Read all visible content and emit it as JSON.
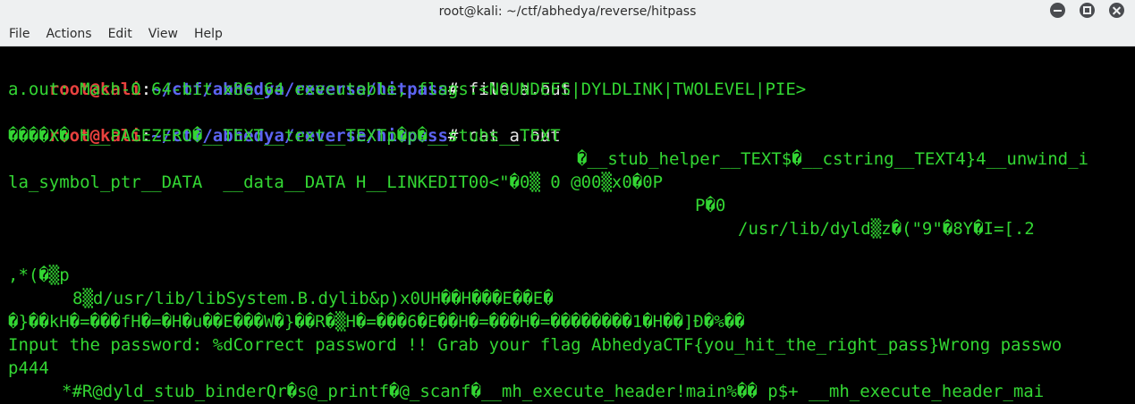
{
  "window": {
    "title": "root@kali: ~/ctf/abhedya/reverse/hitpass",
    "buttons": [
      "minimize-icon",
      "maximize-icon",
      "close-icon"
    ]
  },
  "menu": [
    "File",
    "Actions",
    "Edit",
    "View",
    "Help"
  ],
  "prompt": {
    "user": "root@kali",
    "sep": ":",
    "path": "~/ctf/abhedya/reverse/hitpass",
    "symbol": "# "
  },
  "terminal": {
    "cmd1": "file a.out",
    "out1": "a.out: Mach-O 64-bit x86_64 executable, flags:<NOUNDEFS|DYLDLINK|TWOLEVEL|PIE>",
    "cmd2": "cat a.out",
    "bin1": "����X� H__PAGEZERO�__TEXT__text__TEXTp�p�__stubs__TEXT",
    "bin2": "�__stub_helper__TEXT$�__cstring__TEXT4}4__unwind_i",
    "bin3": "la_symbol_ptr__DATA  __data__DATA H__LINKEDIT00<\"�0▒ 0 @00▒x0�0P",
    "bin4": "P�0",
    "bin5": "/usr/lib/dyld▒z�(\"9\"�8Y�I=[.2",
    "bin6": ",*(�▒p",
    "bin7": "8▒d/usr/lib/libSystem.B.dylib&p)x0UH��H���E��E�",
    "bin8": "�}��kH�=���fH�=�H�u��E���W�}��R�▒H�=���6�E��H�=���H�=��������1�H��]Ð�%��",
    "bin9": "Input the password: %dCorrect password !! Grab your flag AbhedyaCTF{you_hit_the_right_pass}Wrong passwo",
    "bin10": "p444",
    "bin11": "*#R@dyld_stub_binderQr�s@_printf�@_scanf�__mh_execute_header!main%�� p$+ __mh_execute_header_mai"
  },
  "colors": {
    "titlebar_bg": "#eef0f1",
    "terminal_bg": "#000000",
    "text_green": "#33d633",
    "prompt_user_red": "#e8413e",
    "prompt_path_blue": "#5c64f2"
  }
}
